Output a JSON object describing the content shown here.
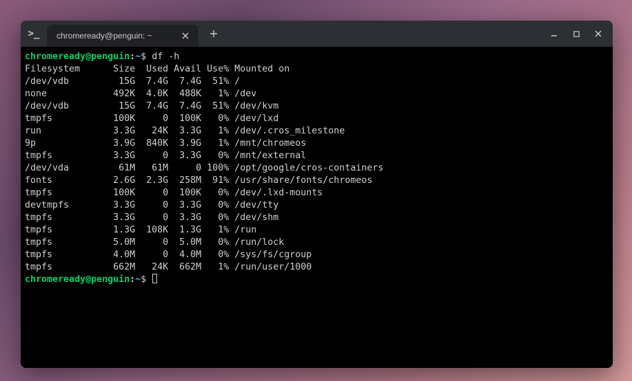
{
  "window": {
    "tab_title": "chromeready@penguin: ~",
    "app_icon_glyph": ">_"
  },
  "prompt": {
    "user": "chromeready",
    "at": "@",
    "host": "penguin",
    "colon": ":",
    "path": "~",
    "dollar": "$"
  },
  "commands": {
    "cmd1": "df -h"
  },
  "output": {
    "header": "Filesystem      Size  Used Avail Use% Mounted on",
    "rows": [
      "/dev/vdb         15G  7.4G  7.4G  51% /",
      "none            492K  4.0K  488K   1% /dev",
      "/dev/vdb         15G  7.4G  7.4G  51% /dev/kvm",
      "tmpfs           100K     0  100K   0% /dev/lxd",
      "run             3.3G   24K  3.3G   1% /dev/.cros_milestone",
      "9p              3.9G  840K  3.9G   1% /mnt/chromeos",
      "tmpfs           3.3G     0  3.3G   0% /mnt/external",
      "/dev/vda         61M   61M     0 100% /opt/google/cros-containers",
      "fonts           2.6G  2.3G  258M  91% /usr/share/fonts/chromeos",
      "tmpfs           100K     0  100K   0% /dev/.lxd-mounts",
      "devtmpfs        3.3G     0  3.3G   0% /dev/tty",
      "tmpfs           3.3G     0  3.3G   0% /dev/shm",
      "tmpfs           1.3G  108K  1.3G   1% /run",
      "tmpfs           5.0M     0  5.0M   0% /run/lock",
      "tmpfs           4.0M     0  4.0M   0% /sys/fs/cgroup",
      "tmpfs           662M   24K  662M   1% /run/user/1000"
    ]
  },
  "icons": {
    "close_tab": "×",
    "new_tab": "+",
    "minimize": "–"
  }
}
